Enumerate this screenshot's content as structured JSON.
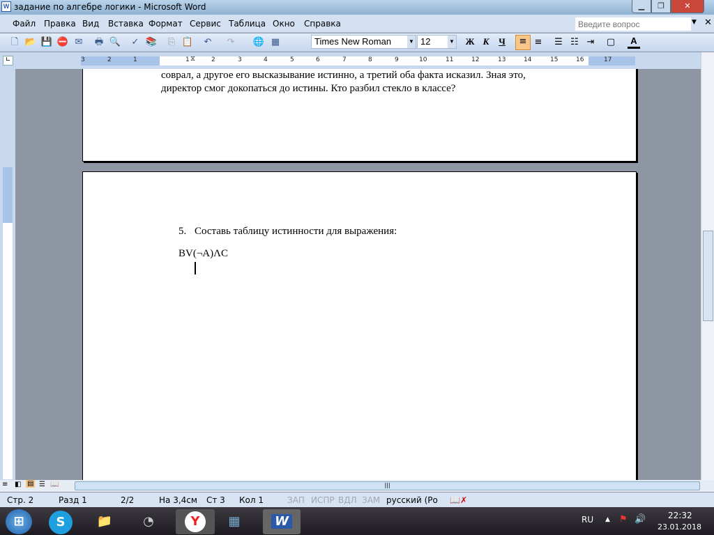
{
  "window": {
    "title": "задание  по алгебре логики - Microsoft Word",
    "app_icon": "W"
  },
  "menu": [
    "Файл",
    "Правка",
    "Вид",
    "Вставка",
    "Формат",
    "Сервис",
    "Таблица",
    "Окно",
    "Справка"
  ],
  "help": {
    "placeholder": "Введите вопрос"
  },
  "toolbar": {
    "font": "Times New Roman",
    "size": "12",
    "bold": "Ж",
    "italic": "К",
    "underline": "Ч",
    "font_color": "A"
  },
  "ruler": {
    "left": [
      "3",
      "2",
      "1"
    ],
    "right": [
      "1",
      "2",
      "3",
      "4",
      "5",
      "6",
      "7",
      "8",
      "9",
      "10",
      "11",
      "12",
      "13",
      "14",
      "15",
      "16",
      "17"
    ]
  },
  "page1": {
    "line1": "соврал, а другое его высказывание истинно, а третий оба факта исказил. Зная это,",
    "line2": "директор смог докопаться до истины. Кто разбил стекло в классе?"
  },
  "page2": {
    "item_number": "5.",
    "item_text": "Составь таблицу истинности для выражения:",
    "expression": "BV(¬A)ΛC"
  },
  "status": {
    "page": "Стр. 2",
    "section": "Разд 1",
    "pages": "2/2",
    "at": "На 3,4см",
    "line": "Ст 3",
    "col": "Кол 1",
    "rec": "ЗАП",
    "trk": "ИСПР",
    "ext": "ВДЛ",
    "ovr": "ЗАМ",
    "lang": "русский (Ро"
  },
  "tray": {
    "lang": "RU",
    "time": "22:32",
    "date": "23.01.2018"
  },
  "colors": {
    "accent": "#f9c68a",
    "taskbar": "#2a282e"
  }
}
